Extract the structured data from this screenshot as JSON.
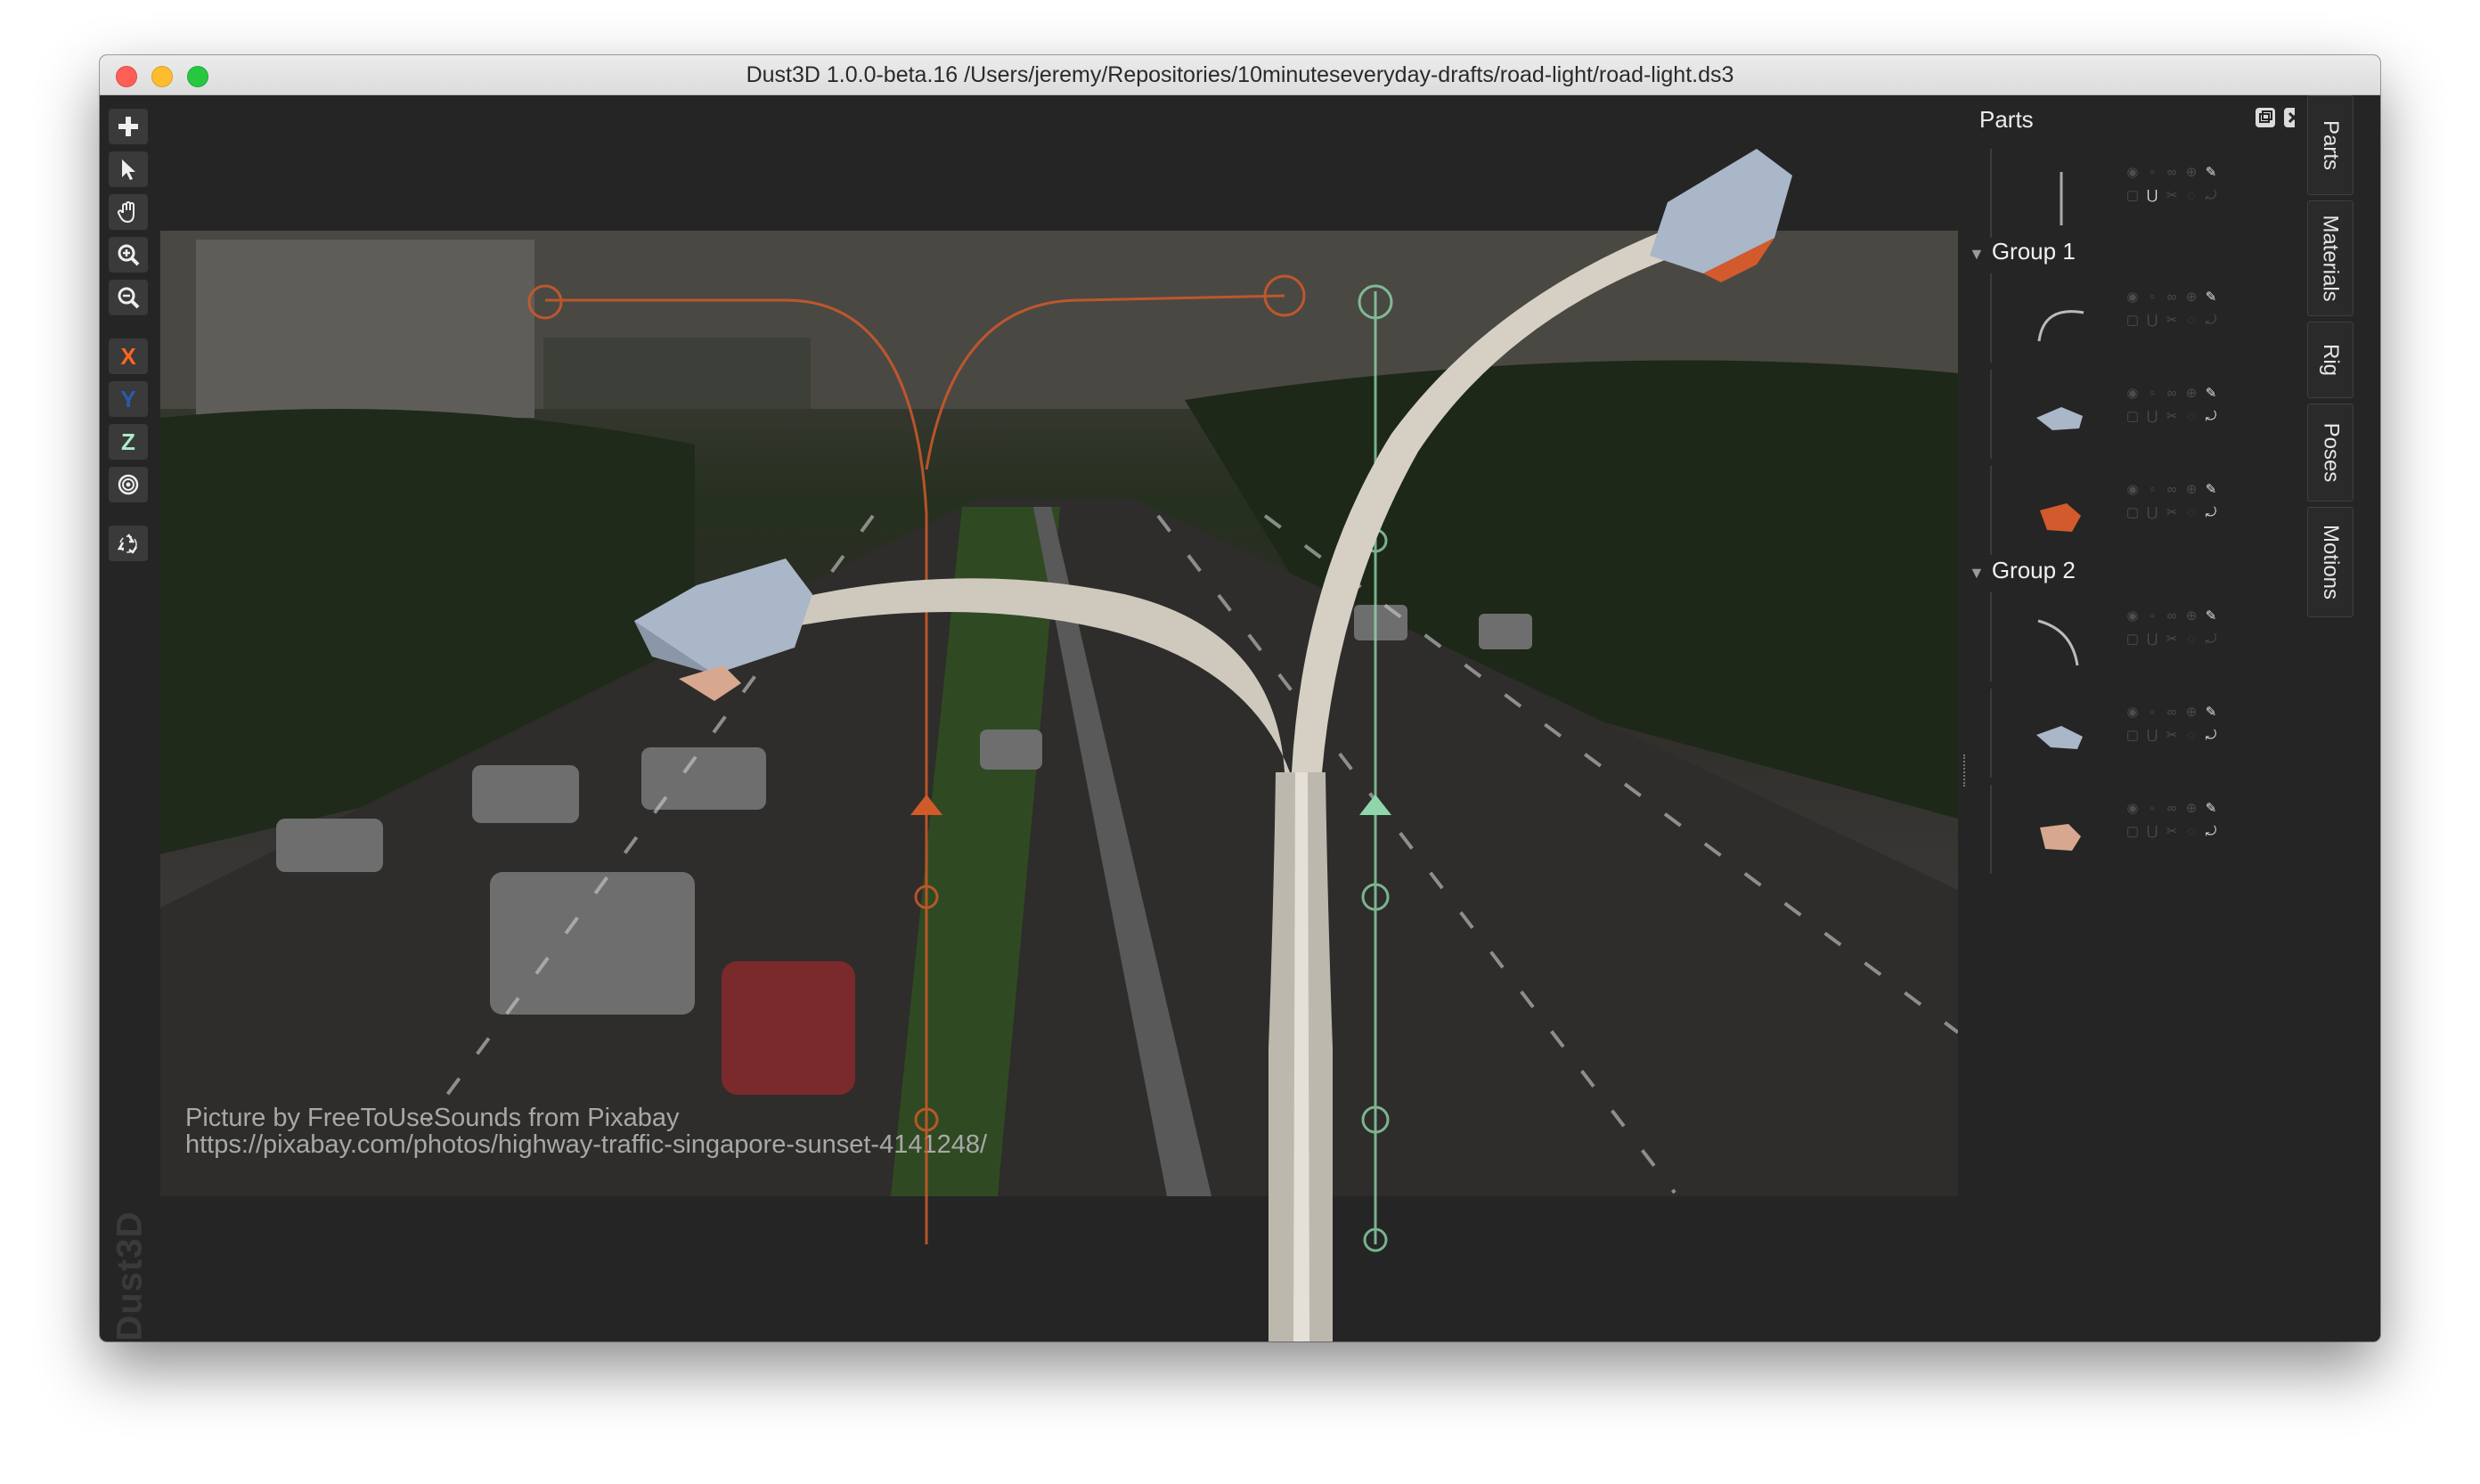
{
  "window": {
    "title": "Dust3D 1.0.0-beta.16 /Users/jeremy/Repositories/10minuteseveryday-drafts/road-light/road-light.ds3"
  },
  "toolbar": {
    "add_icon": "plus-icon",
    "select_icon": "arrow-pointer-icon",
    "pan_icon": "hand-icon",
    "zoom_in_icon": "zoom-in-icon",
    "zoom_out_icon": "zoom-out-icon",
    "x_label": "X",
    "y_label": "Y",
    "z_label": "Z",
    "radius_icon": "concentric-circles-icon",
    "regenerate_icon": "recycle-icon"
  },
  "brand": {
    "text": "Dust3D"
  },
  "viewport": {
    "credit_line1": "Picture by FreeToUseSounds from Pixabay",
    "credit_line2": "https://pixabay.com/photos/highway-traffic-singapore-sunset-4141248/"
  },
  "parts_panel": {
    "title": "Parts",
    "groups": [
      {
        "label": "Group 1"
      },
      {
        "label": "Group 2"
      }
    ]
  },
  "side_tabs": [
    "Parts",
    "Materials",
    "Rig",
    "Poses",
    "Motions"
  ],
  "colors": {
    "axis_x": "#fc6621",
    "axis_y": "#2a5aac",
    "axis_z": "#aaebc4",
    "lamp_head": "#a9b7c8",
    "lamp_orange": "#d35a2c",
    "lamp_skin": "#d7a88f",
    "pole": "#cfc9bd"
  }
}
